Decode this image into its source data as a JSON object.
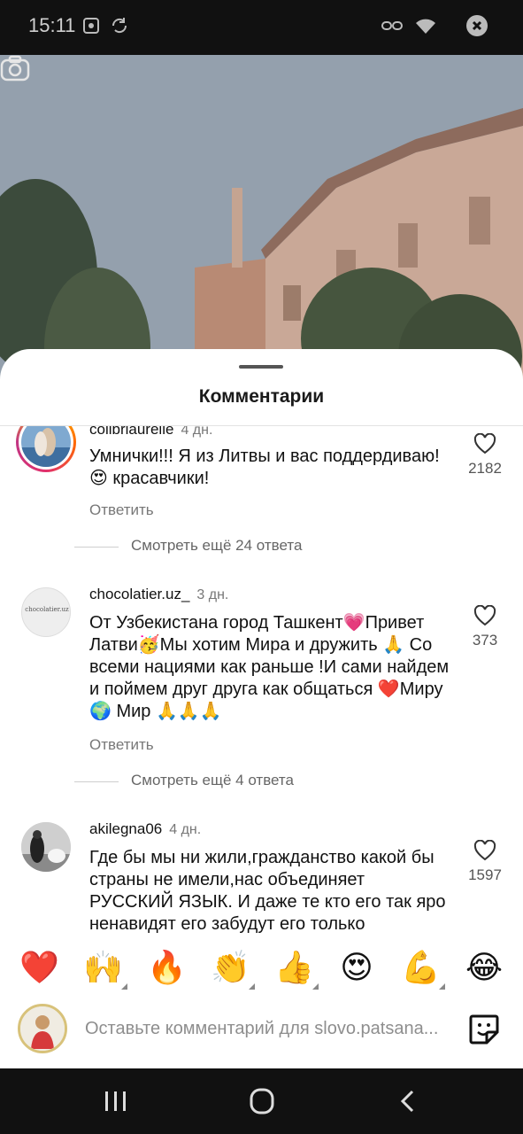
{
  "status_bar": {
    "time": "15:11",
    "icons": [
      "screenshot-icon",
      "sync-icon",
      "link-icon",
      "wifi-icon",
      "dnd-icon"
    ]
  },
  "video": {
    "camera_button_icon": "camera-icon"
  },
  "sheet": {
    "title": "Комментарии"
  },
  "comments": [
    {
      "username": "colibriaurelie",
      "time": "4 дн.",
      "text": "Умнички!!! Я из Литвы и вас поддердиваю! 😍 красавчики!",
      "likes": "2182",
      "reply_label": "Ответить",
      "more_replies": "Смотреть ещё 24 ответа",
      "has_story_ring": true
    },
    {
      "username": "chocolatier.uz_",
      "time": "3 дн.",
      "text": "От Узбекистана город Ташкент💗Привет Латви🥳Мы хотим Мира и дружить 🙏 Со всеми нациями как раньше !И сами найдем и поймем друг друга как общаться ❤️Миру 🌍 Мир 🙏🙏🙏",
      "likes": "373",
      "reply_label": "Ответить",
      "more_replies": "Смотреть ещё 4 ответа",
      "avatar_text": "chocolatier.uz",
      "has_story_ring": false
    },
    {
      "username": "akilegna06",
      "time": "4 дн.",
      "text": "Где бы мы ни жили,гражданство какой бы страны не имели,нас объединяет РУССКИЙ ЯЗЫК. И даже те кто его так яро ненавидят его забудут его только",
      "likes": "1597",
      "has_story_ring": false
    }
  ],
  "emoji_bar": {
    "emojis": [
      "❤️",
      "🙌",
      "🔥",
      "👏",
      "👍",
      "😍",
      "💪",
      "😂"
    ]
  },
  "input": {
    "placeholder": "Оставьте комментарий для slovo.patsana...",
    "sticker_icon": "sticker-icon"
  },
  "navbar": {
    "icons": [
      "recent-apps-icon",
      "home-icon",
      "back-icon"
    ]
  },
  "colors": {
    "sheet_bg": "#ffffff",
    "text": "#111111",
    "muted": "#777777",
    "heart_red": "#ee1d52"
  }
}
